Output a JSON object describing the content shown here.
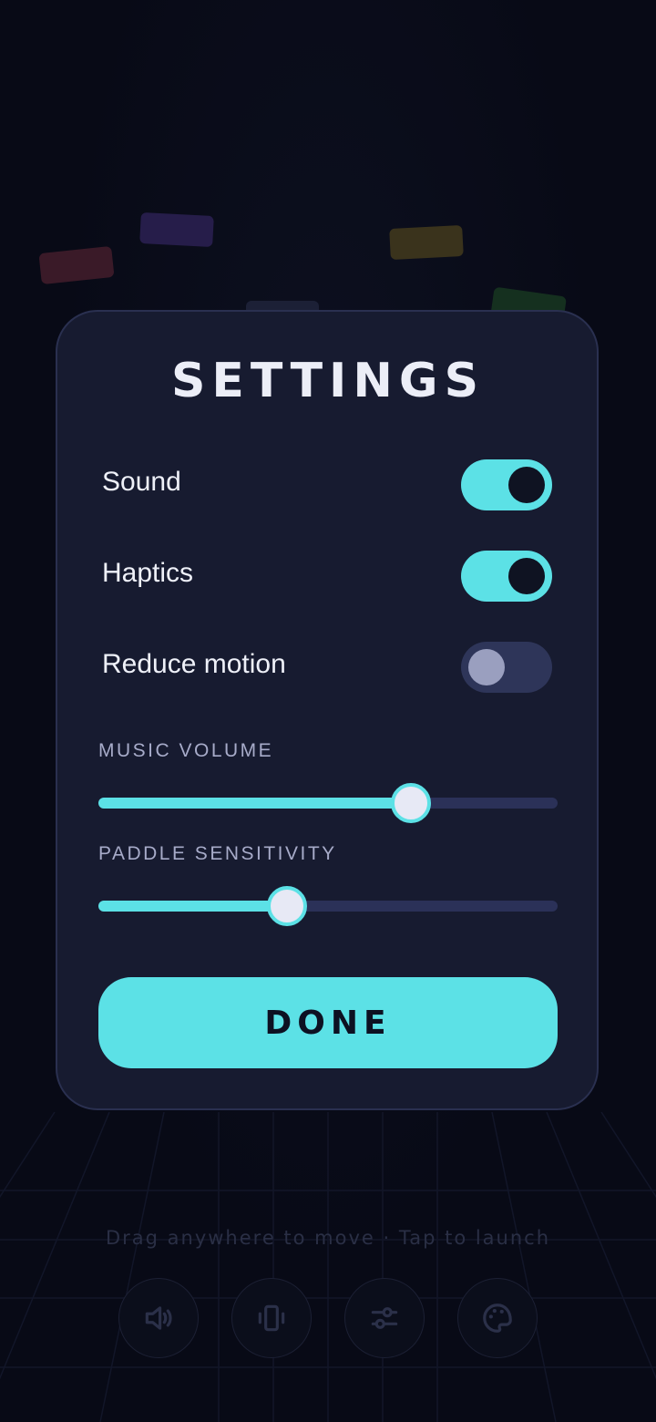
{
  "modal": {
    "title": "SETTINGS",
    "toggles": [
      {
        "label": "Sound",
        "on": true
      },
      {
        "label": "Haptics",
        "on": true
      },
      {
        "label": "Reduce motion",
        "on": false
      }
    ],
    "sliders": [
      {
        "label": "MUSIC VOLUME",
        "value": 0.68
      },
      {
        "label": "PADDLE SENSITIVITY",
        "value": 0.41
      }
    ],
    "done_label": "DONE"
  },
  "background": {
    "hint": "Drag anywhere to move  ·  Tap to launch",
    "dock_icons": [
      "speaker-icon",
      "vibrate-icon",
      "sliders-icon",
      "palette-icon"
    ]
  },
  "colors": {
    "accent": "#5ce1e6",
    "panel": "#171b30",
    "background": "#080a16",
    "track_off": "#2e3559"
  }
}
